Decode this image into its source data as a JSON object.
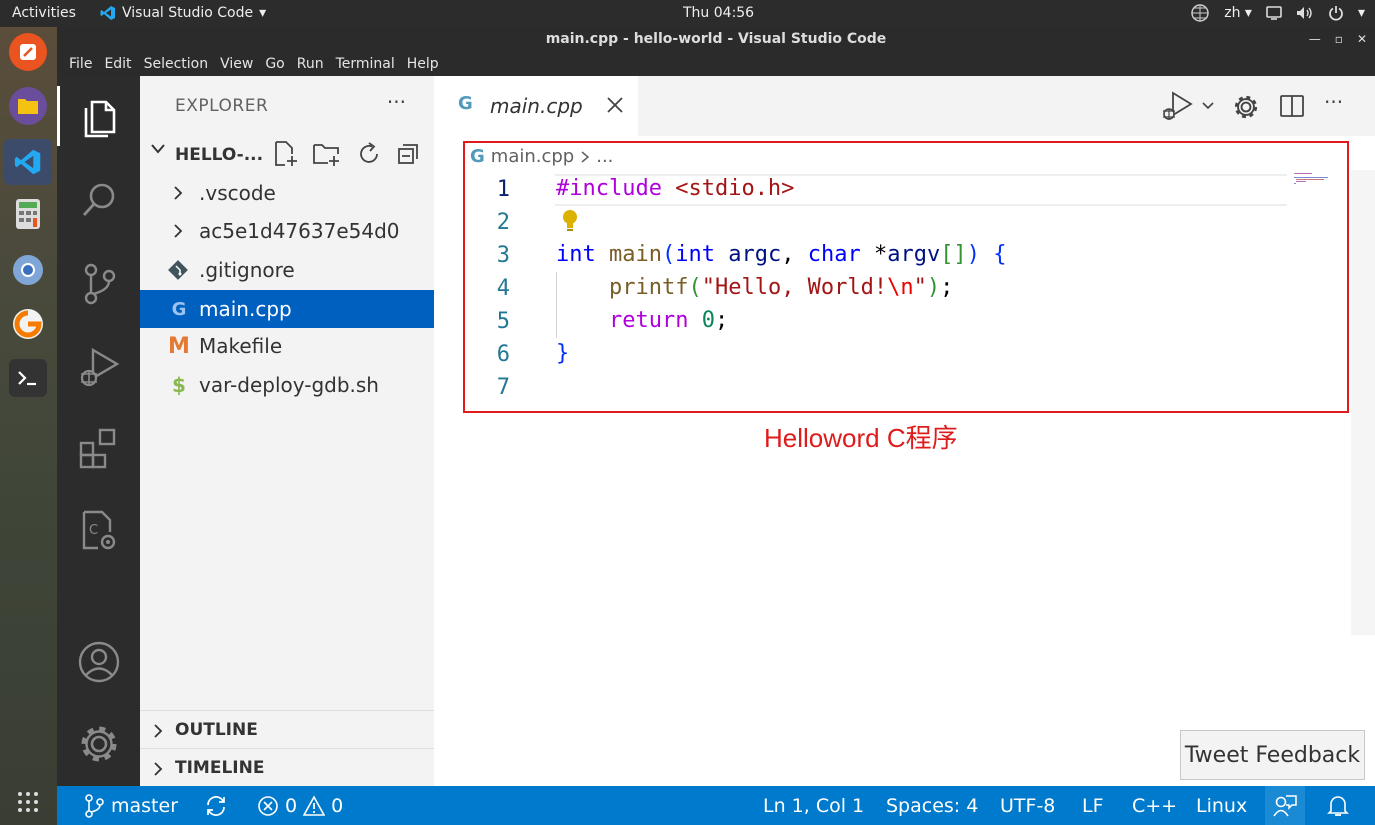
{
  "os": {
    "activities": "Activities",
    "app_name": "Visual Studio Code",
    "clock": "Thu 04:56",
    "language": "zh"
  },
  "window": {
    "title": "main.cpp - hello-world - Visual Studio Code"
  },
  "menu": [
    "File",
    "Edit",
    "Selection",
    "View",
    "Go",
    "Run",
    "Terminal",
    "Help"
  ],
  "explorer": {
    "header": "EXPLORER",
    "project": "HELLO-...",
    "items": [
      {
        "label": ".vscode",
        "icon": "chevron-right-icon"
      },
      {
        "label": "ac5e1d47637e54d0",
        "icon": "chevron-right-icon"
      },
      {
        "label": ".gitignore",
        "icon": "git-icon"
      },
      {
        "label": "main.cpp",
        "icon": "cpp-icon"
      },
      {
        "label": "Makefile",
        "icon": "makefile-icon"
      },
      {
        "label": "var-deploy-gdb.sh",
        "icon": "shell-icon"
      }
    ],
    "outline": "OUTLINE",
    "timeline": "TIMELINE"
  },
  "editor": {
    "tab_label": "main.cpp",
    "breadcrumb_file": "main.cpp",
    "breadcrumb_more": "...",
    "line_numbers": [
      "1",
      "2",
      "3",
      "4",
      "5",
      "6",
      "7"
    ],
    "annotation": "Helloword C程序"
  },
  "tooltip": "Tweet Feedback",
  "status": {
    "branch": "master",
    "errors": "0",
    "warnings": "0",
    "position": "Ln 1, Col 1",
    "spaces": "Spaces: 4",
    "encoding": "UTF-8",
    "eol": "LF",
    "language": "C++",
    "os": "Linux"
  },
  "colors": {
    "accent": "#007acc",
    "selection": "#0060c0",
    "annotation": "#e01b1b"
  }
}
